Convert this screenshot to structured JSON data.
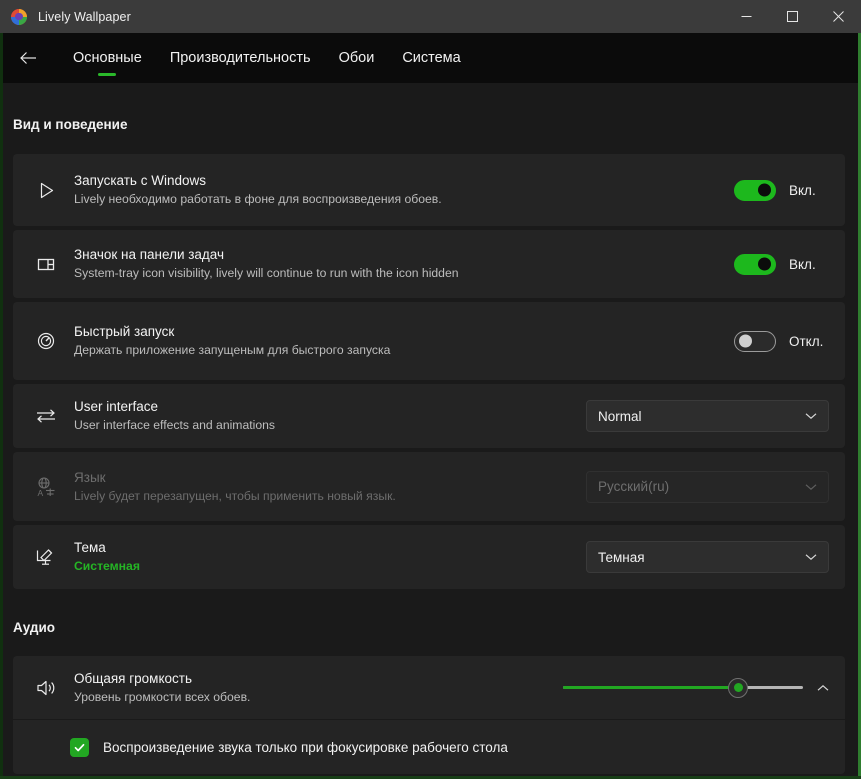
{
  "window": {
    "title": "Lively Wallpaper",
    "app_icon": "lively-logo-icon",
    "controls": {
      "minimize": "minimize-icon",
      "maximize": "maximize-icon",
      "close": "close-icon"
    }
  },
  "nav": {
    "back": "back-arrow-icon",
    "tabs": [
      {
        "label": "Основные",
        "active": true
      },
      {
        "label": "Производительность",
        "active": false
      },
      {
        "label": "Обои",
        "active": false
      },
      {
        "label": "Система",
        "active": false
      }
    ]
  },
  "sections": [
    {
      "title": "Вид и поведение",
      "rows": [
        {
          "icon": "play-icon",
          "title": "Запускать с Windows",
          "subtitle": "Lively необходимо работать в фоне для воспроизведения обоев.",
          "control": "toggle",
          "toggle_state": "on",
          "toggle_label": "Вкл."
        },
        {
          "icon": "taskbar-icon",
          "title": "Значок на панели задач",
          "subtitle": "System-tray icon visibility, lively will continue to run with the icon hidden",
          "control": "toggle",
          "toggle_state": "on",
          "toggle_label": "Вкл."
        },
        {
          "icon": "speedometer-icon",
          "title": "Быстрый запуск",
          "subtitle": "Держать приложение запущеным для быстрого запуска",
          "control": "toggle",
          "toggle_state": "off",
          "toggle_label": "Откл."
        },
        {
          "icon": "swap-arrows-icon",
          "title": "User interface",
          "subtitle": "User interface effects and animations",
          "control": "dropdown",
          "dropdown_value": "Normal"
        },
        {
          "icon": "language-icon",
          "title": "Язык",
          "subtitle": "Lively будет перезапущен, чтобы применить новый язык.",
          "control": "dropdown",
          "dropdown_value": "Русский(ru)",
          "disabled": true
        },
        {
          "icon": "theme-edit-icon",
          "title": "Тема",
          "subtitle": "Системная",
          "subtitle_accent": true,
          "control": "dropdown",
          "dropdown_value": "Темная"
        }
      ]
    }
  ],
  "audio": {
    "title": "Аудио",
    "volume_row": {
      "icon": "speaker-icon",
      "title": "Общаяя громкость",
      "subtitle": "Уровень громкости всех обоев.",
      "slider_percent": 73,
      "expander": "chevron-up-icon"
    },
    "checkbox_row": {
      "checked": true,
      "label": "Воспроизведение звука только при фокусировке рабочего стола"
    }
  },
  "colors": {
    "accent_green": "#1db81d",
    "card_bg": "#242424",
    "page_bg": "#1a1a1a",
    "titlebar_bg": "#3b3b3b"
  }
}
